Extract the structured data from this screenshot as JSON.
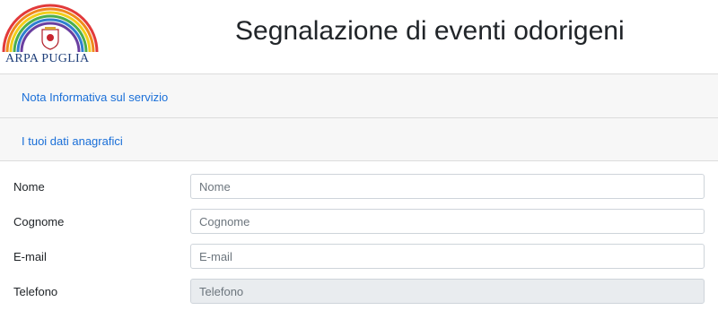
{
  "header": {
    "logo_text": "ARPA PUGLIA",
    "title": "Segnalazione di eventi odorigeni"
  },
  "accordion": [
    {
      "label": "Nota Informativa sul servizio"
    },
    {
      "label": "I tuoi dati anagrafici"
    }
  ],
  "form": {
    "nome": {
      "label": "Nome",
      "placeholder": "Nome",
      "value": ""
    },
    "cognome": {
      "label": "Cognome",
      "placeholder": "Cognome",
      "value": ""
    },
    "email": {
      "label": "E-mail",
      "placeholder": "E-mail",
      "value": ""
    },
    "telefono": {
      "label": "Telefono",
      "placeholder": "Telefono",
      "value": "",
      "disabled": true
    }
  },
  "colors": {
    "link": "#1a6fd8",
    "panel_bg": "#f7f7f7",
    "disabled_input_bg": "#e9ecef",
    "logo_text": "#1f3f7a"
  },
  "icons": {
    "logo": "rainbow-arc-with-shield"
  }
}
